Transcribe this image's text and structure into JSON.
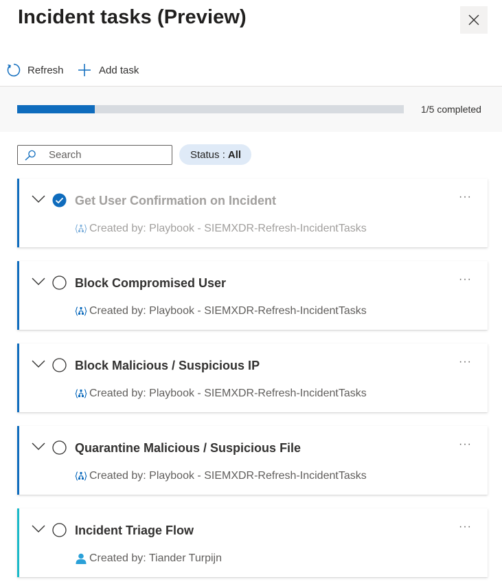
{
  "header": {
    "title": "Incident tasks (Preview)",
    "close_icon": "close-icon"
  },
  "toolbar": {
    "refresh_label": "Refresh",
    "add_task_label": "Add task"
  },
  "progress": {
    "completed": 1,
    "total": 5,
    "fraction": 0.2,
    "label": "1/5 completed",
    "color": "#0f6cbd"
  },
  "filters": {
    "search_placeholder": "Search",
    "status_label": "Status :",
    "status_value": "All"
  },
  "tasks": [
    {
      "title": "Get User Confirmation on Incident",
      "completed": true,
      "created_by": "Created by: Playbook - SIEMXDR-Refresh-IncidentTasks",
      "creator_icon": "playbook-icon"
    },
    {
      "title": "Block Compromised User",
      "completed": false,
      "created_by": "Created by: Playbook - SIEMXDR-Refresh-IncidentTasks",
      "creator_icon": "playbook-icon"
    },
    {
      "title": "Block Malicious / Suspicious IP",
      "completed": false,
      "created_by": "Created by: Playbook - SIEMXDR-Refresh-IncidentTasks",
      "creator_icon": "playbook-icon"
    },
    {
      "title": "Quarantine Malicious / Suspicious File",
      "completed": false,
      "created_by": "Created by: Playbook - SIEMXDR-Refresh-IncidentTasks",
      "creator_icon": "playbook-icon"
    },
    {
      "title": "Incident Triage Flow",
      "completed": false,
      "created_by": "Created by: Tiander Turpijn",
      "creator_icon": "user-icon"
    }
  ],
  "colors": {
    "accent": "#0f6cbd",
    "manual_task_accent": "#1ab9c8"
  }
}
